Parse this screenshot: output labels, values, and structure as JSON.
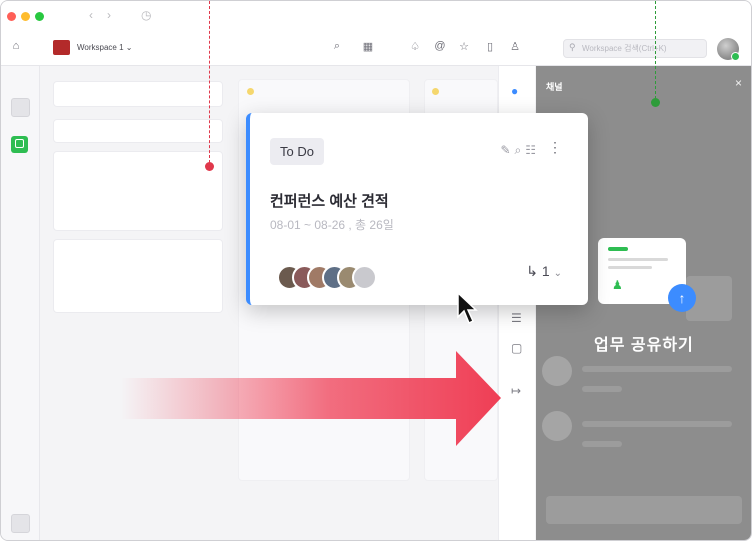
{
  "window": {
    "traffic_lights": [
      "#ff5f57",
      "#febc2e",
      "#28c840"
    ]
  },
  "toolbar": {
    "workspace_name": "Workspace 1",
    "workspace_chevron": "⌄",
    "search_placeholder": "Workspace 검색(Ctrl+K)",
    "icons": [
      "chat-search-icon",
      "table-icon",
      "bell-icon",
      "at-icon",
      "star-icon",
      "doc-icon",
      "people-icon",
      "search-icon"
    ]
  },
  "popup": {
    "status": "To Do",
    "title": "컨퍼런스 예산 견적",
    "dates": "08-01 ~ 08-26 , 총 26일",
    "subtask_count": "1",
    "accent": "#3c8cff"
  },
  "panel": {
    "title": "채널",
    "close": "×",
    "share_label": "업무 공유하기"
  },
  "colors": {
    "leader_left": "#e0384b",
    "leader_right": "#2e9c3a",
    "arrow": "#ef3e55",
    "share_button": "#3c8cff"
  }
}
